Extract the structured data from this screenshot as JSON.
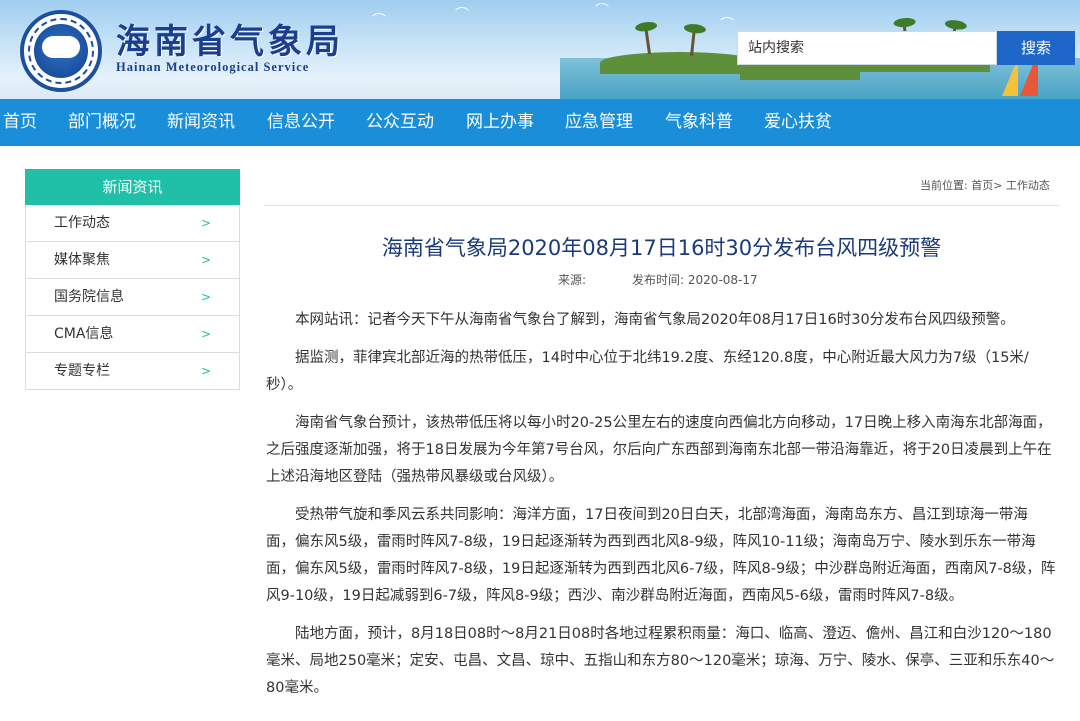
{
  "header": {
    "title": "海南省气象局",
    "subtitle": "Hainan Meteorological Service",
    "search": {
      "placeholder": "站内搜索",
      "button_label": "搜索"
    }
  },
  "nav": {
    "items": [
      {
        "label": "首页"
      },
      {
        "label": "部门概况"
      },
      {
        "label": "新闻资讯"
      },
      {
        "label": "信息公开"
      },
      {
        "label": "公众互动"
      },
      {
        "label": "网上办事"
      },
      {
        "label": "应急管理"
      },
      {
        "label": "气象科普"
      },
      {
        "label": "爱心扶贫"
      }
    ]
  },
  "sidebar": {
    "heading": "新闻资讯",
    "items": [
      {
        "label": "工作动态",
        "arrow": ">"
      },
      {
        "label": "媒体聚焦",
        "arrow": ">"
      },
      {
        "label": "国务院信息",
        "arrow": ">"
      },
      {
        "label": "CMA信息",
        "arrow": ">"
      },
      {
        "label": "专题专栏",
        "arrow": ">"
      }
    ]
  },
  "breadcrumb": {
    "text": "当前位置: 首页> 工作动态"
  },
  "article": {
    "title": "海南省气象局2020年08月17日16时30分发布台风四级预警",
    "source": "来源:",
    "date": "发布时间: 2020-08-17",
    "paragraphs": [
      "本网站讯：记者今天下午从海南省气象台了解到，海南省气象局2020年08月17日16时30分发布台风四级预警。",
      "据监测，菲律宾北部近海的热带低压，14时中心位于北纬19.2度、东经120.8度，中心附近最大风力为7级（15米/秒）。",
      "海南省气象台预计，该热带低压将以每小时20-25公里左右的速度向西偏北方向移动，17日晚上移入南海东北部海面，之后强度逐渐加强，将于18日发展为今年第7号台风，尔后向广东西部到海南东北部一带沿海靠近，将于20日凌晨到上午在上述沿海地区登陆（强热带风暴级或台风级）。",
      "受热带气旋和季风云系共同影响：海洋方面，17日夜间到20日白天，北部湾海面，海南岛东方、昌江到琼海一带海面，偏东风5级，雷雨时阵风7-8级，19日起逐渐转为西到西北风8-9级，阵风10-11级；海南岛万宁、陵水到乐东一带海面，偏东风5级，雷雨时阵风7-8级，19日起逐渐转为西到西北风6-7级，阵风8-9级；中沙群岛附近海面，西南风7-8级，阵风9-10级，19日起减弱到6-7级，阵风8-9级；西沙、南沙群岛附近海面，西南风5-6级，雷雨时阵风7-8级。",
      "陆地方面，预计，8月18日08时～8月21日08时各地过程累积雨量：海口、临高、澄迈、儋州、昌江和白沙120～180毫米、局地250毫米；定安、屯昌、文昌、琼中、五指山和东方80～120毫米；琼海、万宁、陵水、保亭、三亚和乐东40～80毫米。"
    ]
  }
}
